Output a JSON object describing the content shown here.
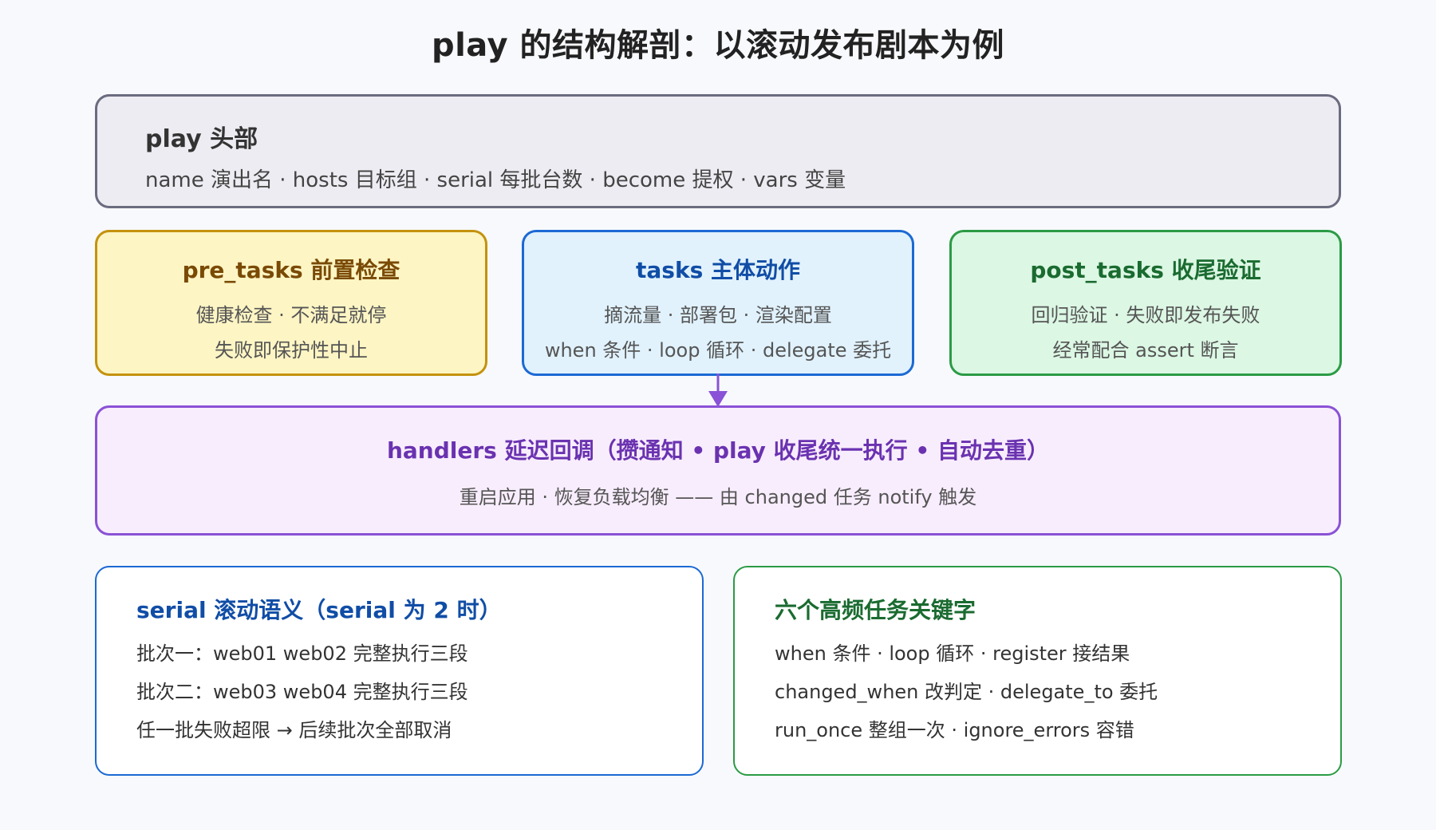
{
  "title": "play 的结构解剖：以滚动发布剧本为例",
  "header": {
    "title": "play 头部",
    "desc": "name 演出名 · hosts 目标组 · serial 每批台数 · become 提权 · vars 变量"
  },
  "stages": {
    "pre_tasks": {
      "title": "pre_tasks 前置检查",
      "line1": "健康检查 · 不满足就停",
      "line2": "失败即保护性中止"
    },
    "tasks": {
      "title": "tasks 主体动作",
      "line1": "摘流量 · 部署包 · 渲染配置",
      "line2": "when 条件 · loop 循环 · delegate 委托"
    },
    "post_tasks": {
      "title": "post_tasks 收尾验证",
      "line1": "回归验证 · 失败即发布失败",
      "line2": "经常配合 assert 断言"
    }
  },
  "handlers": {
    "title": "handlers 延迟回调（攒通知 • play 收尾统一执行 • 自动去重）",
    "desc": "重启应用 · 恢复负载均衡 —— 由 changed 任务 notify 触发"
  },
  "serial_panel": {
    "title": "serial 滚动语义（serial 为 2 时）",
    "lines": [
      "批次一：web01 web02 完整执行三段",
      "批次二：web03 web04 完整执行三段",
      "任一批失败超限 → 后续批次全部取消"
    ]
  },
  "keywords_panel": {
    "title": "六个高频任务关键字",
    "lines": [
      "when 条件 · loop 循环 · register 接结果",
      "changed_when 改判定 · delegate_to 委托",
      "run_once 整组一次 · ignore_errors 容错"
    ]
  },
  "colors": {
    "pre_tasks": "#c4920e",
    "tasks": "#1c69d4",
    "post_tasks": "#2b9b45",
    "handlers": "#8a52d6",
    "header": "#6b6b80"
  }
}
